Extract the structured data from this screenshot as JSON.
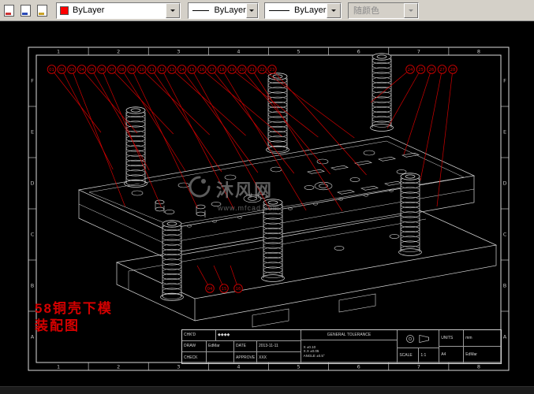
{
  "toolbar": {
    "color_control": {
      "value": "ByLayer",
      "swatch": "#ff0000"
    },
    "linetype_control": {
      "value": "ByLayer"
    },
    "lineweight_control": {
      "value": "ByLayer"
    },
    "plotstyle_control": {
      "value": "随颜色"
    }
  },
  "frame": {
    "column_labels": [
      "1",
      "2",
      "3",
      "4",
      "5",
      "6",
      "7",
      "8"
    ],
    "row_labels": [
      "F",
      "E",
      "D",
      "C",
      "B",
      "A"
    ]
  },
  "callouts": {
    "top": [
      "01",
      "02",
      "03",
      "04",
      "05",
      "06",
      "07",
      "08",
      "09",
      "10",
      "11",
      "12",
      "13",
      "14",
      "15",
      "16",
      "17",
      "18",
      "19",
      "20",
      "21",
      "22",
      "23"
    ],
    "right": [
      "24",
      "25",
      "26",
      "27",
      "28"
    ],
    "bottom": [
      "04",
      "15",
      "16"
    ]
  },
  "annotation": {
    "line1": "58铜壳下模",
    "line2": "装配图"
  },
  "watermark": {
    "brand": "沐风网",
    "url": "www.mfcad.com"
  },
  "colors": {
    "callout": "#d00000",
    "wireframe": "#d9d9d9",
    "annotation": "#d40000"
  },
  "titleblock": {
    "chkd_label": "CHK'D",
    "company": "◆◆◆◆",
    "draw_label": "DRAW",
    "draw_value": "EdMar",
    "date_label": "DATE",
    "date_value": "2013-11-11",
    "check_label": "CHECK",
    "approve_label": "APPROVE",
    "approve_value": "XXX",
    "tol_title": "GENERAL TOLERANCE",
    "tol1": "X ±0.10",
    "tol2": "X.X ±0.05",
    "tol3": "ANGLE ±0.5°",
    "scale_label": "SCALE",
    "scale_value": "1:1",
    "units_label": "UNITS",
    "units_value": "mm",
    "size_value": "A4",
    "rev_value": "EdMar"
  }
}
